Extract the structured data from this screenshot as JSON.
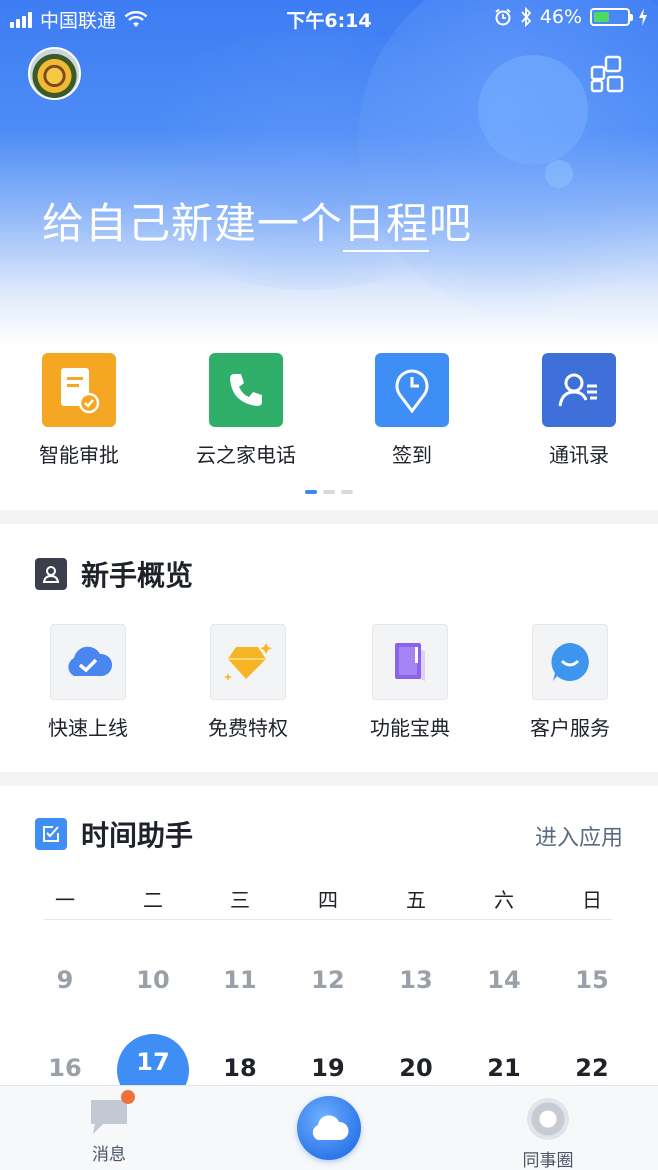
{
  "status_bar": {
    "carrier": "中国联通",
    "time": "下午6:14",
    "battery": "46%"
  },
  "hero": {
    "text_pre": "给自己新建一个",
    "text_link": "日程",
    "text_post": "吧"
  },
  "apps": {
    "items": [
      {
        "label": "智能审批",
        "icon": "approval-icon",
        "color": "#f5a623"
      },
      {
        "label": "云之家电话",
        "icon": "phone-icon",
        "color": "#2fae69"
      },
      {
        "label": "签到",
        "icon": "location-clock-icon",
        "color": "#3f8ef5"
      },
      {
        "label": "通讯录",
        "icon": "contacts-icon",
        "color": "#3f6fd8"
      }
    ],
    "page_count": 3,
    "current_page": 1
  },
  "newbie": {
    "title": "新手概览",
    "items": [
      {
        "label": "快速上线",
        "icon": "cloud-check-icon"
      },
      {
        "label": "免费特权",
        "icon": "diamond-icon"
      },
      {
        "label": "功能宝典",
        "icon": "book-icon"
      },
      {
        "label": "客户服务",
        "icon": "service-bubble-icon"
      }
    ]
  },
  "time_assistant": {
    "title": "时间助手",
    "enter_link": "进入应用",
    "weekdays": [
      "一",
      "二",
      "三",
      "四",
      "五",
      "六",
      "日"
    ],
    "week1": [
      "9",
      "10",
      "11",
      "12",
      "13",
      "14",
      "15"
    ],
    "week2": [
      "16",
      "17",
      "18",
      "19",
      "20",
      "21",
      "22"
    ],
    "today": "17"
  },
  "tabbar": {
    "messages": "消息",
    "colleagues": "同事圈"
  },
  "colors": {
    "accent": "#3f8ef5",
    "badge": "#f2703a"
  }
}
